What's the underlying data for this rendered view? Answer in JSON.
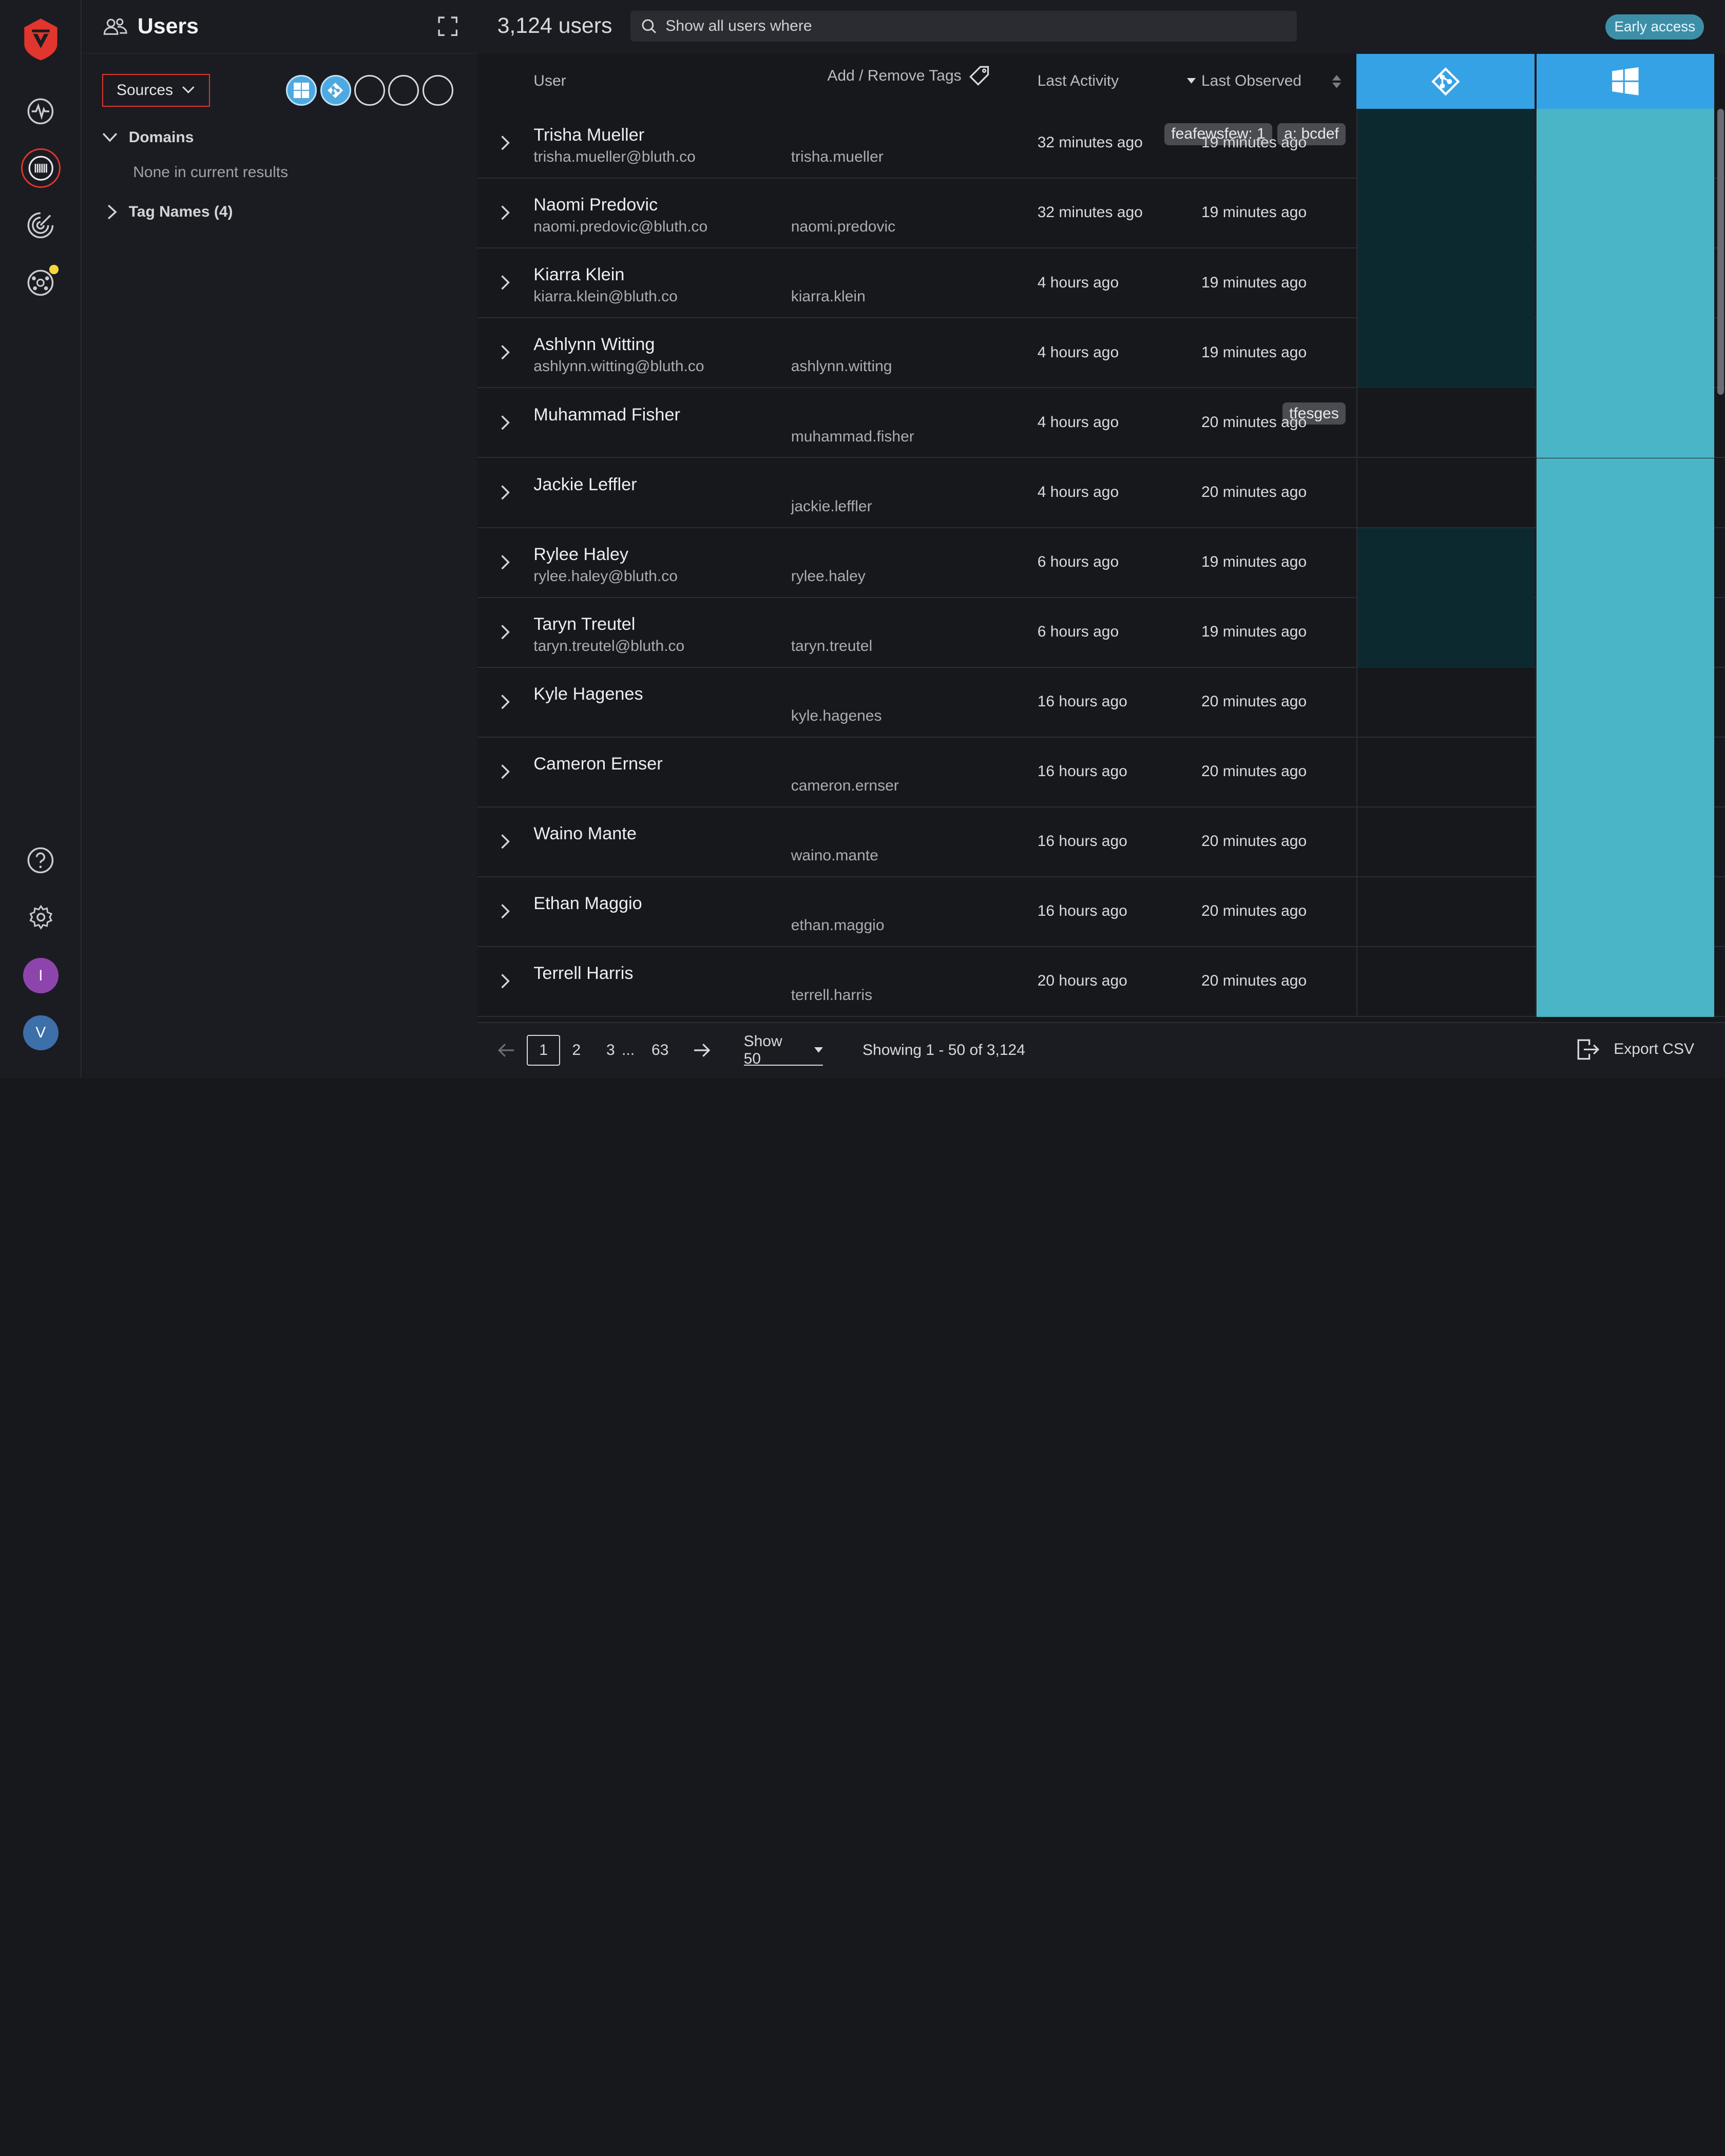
{
  "panel": {
    "title": "Users",
    "sources_label": "Sources",
    "domains_label": "Domains",
    "domains_empty": "None in current results",
    "tag_names_label": "Tag Names (4)"
  },
  "header": {
    "user_count": "3,124 users",
    "search_placeholder": "Show all users where",
    "early_access": "Early access"
  },
  "table": {
    "columns": {
      "user": "User",
      "tags": "Add / Remove Tags",
      "last_activity": "Last Activity",
      "last_observed": "Last Observed"
    },
    "rows": [
      {
        "name": "Trisha Mueller",
        "email": "trisha.mueller@bluth.co",
        "username": "trisha.mueller",
        "tags": [
          "feafewsfew: 1",
          "a: bcdef"
        ],
        "last_activity": "32 minutes ago",
        "last_observed": "19 minutes ago",
        "src_a": true
      },
      {
        "name": "Naomi Predovic",
        "email": "naomi.predovic@bluth.co",
        "username": "naomi.predovic",
        "tags": [],
        "last_activity": "32 minutes ago",
        "last_observed": "19 minutes ago",
        "src_a": true
      },
      {
        "name": "Kiarra Klein",
        "email": "kiarra.klein@bluth.co",
        "username": "kiarra.klein",
        "tags": [],
        "last_activity": "4 hours ago",
        "last_observed": "19 minutes ago",
        "src_a": true
      },
      {
        "name": "Ashlynn Witting",
        "email": "ashlynn.witting@bluth.co",
        "username": "ashlynn.witting",
        "tags": [],
        "last_activity": "4 hours ago",
        "last_observed": "19 minutes ago",
        "src_a": true
      },
      {
        "name": "Muhammad Fisher",
        "email": "",
        "username": "muhammad.fisher",
        "tags": [
          "tfesges"
        ],
        "last_activity": "4 hours ago",
        "last_observed": "20 minutes ago",
        "src_a": false
      },
      {
        "name": "Jackie Leffler",
        "email": "",
        "username": "jackie.leffler",
        "tags": [],
        "last_activity": "4 hours ago",
        "last_observed": "20 minutes ago",
        "src_a": false
      },
      {
        "name": "Rylee Haley",
        "email": "rylee.haley@bluth.co",
        "username": "rylee.haley",
        "tags": [],
        "last_activity": "6 hours ago",
        "last_observed": "19 minutes ago",
        "src_a": true
      },
      {
        "name": "Taryn Treutel",
        "email": "taryn.treutel@bluth.co",
        "username": "taryn.treutel",
        "tags": [],
        "last_activity": "6 hours ago",
        "last_observed": "19 minutes ago",
        "src_a": true
      },
      {
        "name": "Kyle Hagenes",
        "email": "",
        "username": "kyle.hagenes",
        "tags": [],
        "last_activity": "16 hours ago",
        "last_observed": "20 minutes ago",
        "src_a": false
      },
      {
        "name": "Cameron Ernser",
        "email": "",
        "username": "cameron.ernser",
        "tags": [],
        "last_activity": "16 hours ago",
        "last_observed": "20 minutes ago",
        "src_a": false
      },
      {
        "name": "Waino Mante",
        "email": "",
        "username": "waino.mante",
        "tags": [],
        "last_activity": "16 hours ago",
        "last_observed": "20 minutes ago",
        "src_a": false
      },
      {
        "name": "Ethan Maggio",
        "email": "",
        "username": "ethan.maggio",
        "tags": [],
        "last_activity": "16 hours ago",
        "last_observed": "20 minutes ago",
        "src_a": false
      },
      {
        "name": "Terrell Harris",
        "email": "",
        "username": "terrell.harris",
        "tags": [],
        "last_activity": "20 hours ago",
        "last_observed": "20 minutes ago",
        "src_a": false
      }
    ]
  },
  "footer": {
    "pages": [
      "1",
      "2",
      "3",
      "...",
      "63"
    ],
    "show_label": "Show 50",
    "showing": "Showing 1 - 50 of 3,124",
    "export_label": "Export CSV"
  },
  "avatars": [
    "I",
    "V"
  ],
  "colors": {
    "accent_red": "#e0362d",
    "source_blue": "#36a2e6",
    "source_teal": "#4ab5c6",
    "active_dark": "#0d2930"
  }
}
